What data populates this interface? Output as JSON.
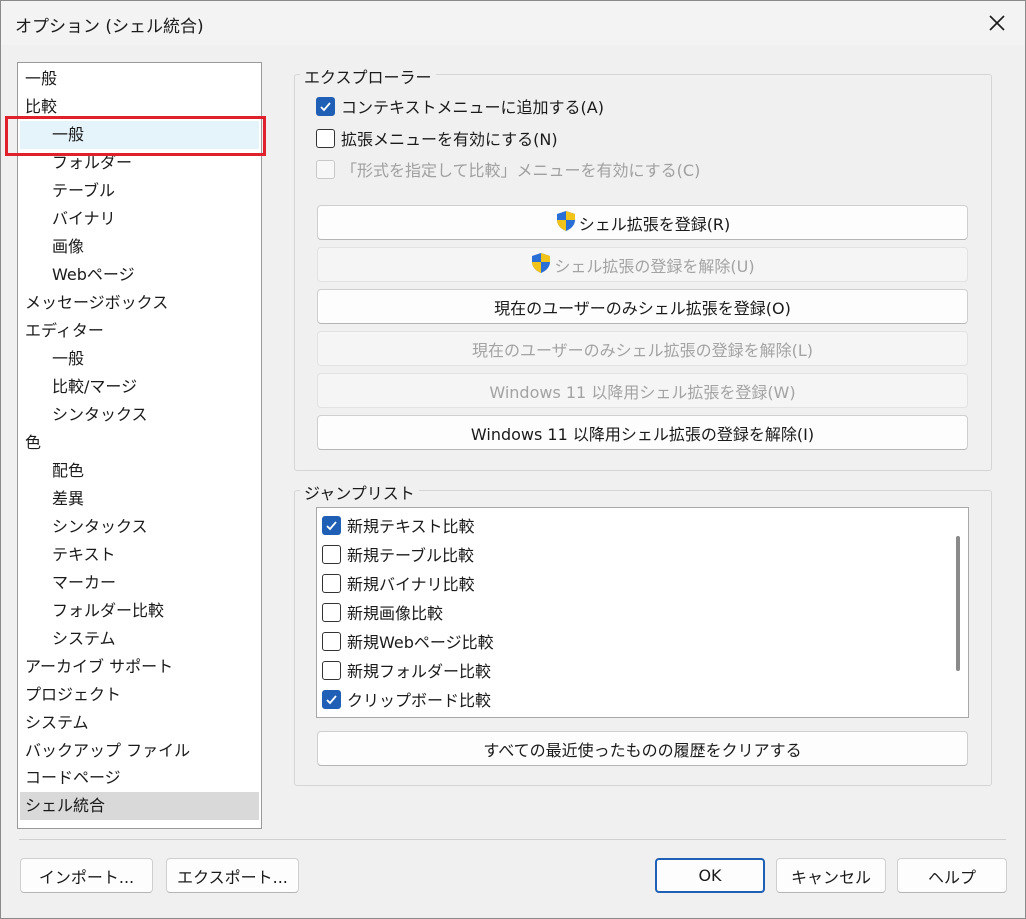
{
  "window": {
    "title": "オプション (シェル統合)"
  },
  "tree": {
    "items": [
      {
        "label": "一般",
        "level": 0
      },
      {
        "label": "比較",
        "level": 0
      },
      {
        "label": "一般",
        "level": 1
      },
      {
        "label": "フォルダー",
        "level": 1
      },
      {
        "label": "テーブル",
        "level": 1
      },
      {
        "label": "バイナリ",
        "level": 1
      },
      {
        "label": "画像",
        "level": 1
      },
      {
        "label": "Webページ",
        "level": 1
      },
      {
        "label": "メッセージボックス",
        "level": 0
      },
      {
        "label": "エディター",
        "level": 0
      },
      {
        "label": "一般",
        "level": 1
      },
      {
        "label": "比較/マージ",
        "level": 1
      },
      {
        "label": "シンタックス",
        "level": 1
      },
      {
        "label": "色",
        "level": 0
      },
      {
        "label": "配色",
        "level": 1
      },
      {
        "label": "差異",
        "level": 1
      },
      {
        "label": "シンタックス",
        "level": 1
      },
      {
        "label": "テキスト",
        "level": 1
      },
      {
        "label": "マーカー",
        "level": 1
      },
      {
        "label": "フォルダー比較",
        "level": 1
      },
      {
        "label": "システム",
        "level": 1
      },
      {
        "label": "アーカイブ サポート",
        "level": 0
      },
      {
        "label": "プロジェクト",
        "level": 0
      },
      {
        "label": "システム",
        "level": 0
      },
      {
        "label": "バックアップ ファイル",
        "level": 0
      },
      {
        "label": "コードページ",
        "level": 0
      },
      {
        "label": "シェル統合",
        "level": 0
      }
    ]
  },
  "explorer": {
    "label": "エクスプローラー",
    "checks": [
      {
        "label": "コンテキストメニューに追加する(A)",
        "checked": true,
        "disabled": false
      },
      {
        "label": "拡張メニューを有効にする(N)",
        "checked": false,
        "disabled": false
      },
      {
        "label": "「形式を指定して比較」メニューを有効にする(C)",
        "checked": false,
        "disabled": true
      }
    ],
    "buttons": [
      {
        "label": "シェル拡張を登録(R)",
        "disabled": false,
        "shield": true
      },
      {
        "label": "シェル拡張の登録を解除(U)",
        "disabled": true,
        "shield": true
      },
      {
        "label": "現在のユーザーのみシェル拡張を登録(O)",
        "disabled": false,
        "shield": false
      },
      {
        "label": "現在のユーザーのみシェル拡張の登録を解除(L)",
        "disabled": true,
        "shield": false
      },
      {
        "label": "Windows 11 以降用シェル拡張を登録(W)",
        "disabled": true,
        "shield": false
      },
      {
        "label": "Windows 11 以降用シェル拡張の登録を解除(I)",
        "disabled": false,
        "shield": false
      }
    ]
  },
  "jumplist": {
    "label": "ジャンプリスト",
    "items": [
      {
        "label": "新規テキスト比較",
        "checked": true
      },
      {
        "label": "新規テーブル比較",
        "checked": false
      },
      {
        "label": "新規バイナリ比較",
        "checked": false
      },
      {
        "label": "新規画像比較",
        "checked": false
      },
      {
        "label": "新規Webページ比較",
        "checked": false
      },
      {
        "label": "新規フォルダー比較",
        "checked": false
      },
      {
        "label": "クリップボード比較",
        "checked": true
      }
    ],
    "clear_button": "すべての最近使ったものの履歴をクリアする"
  },
  "footer": {
    "import": "インポート...",
    "export": "エクスポート...",
    "ok": "OK",
    "cancel": "キャンセル",
    "help": "ヘルプ"
  },
  "colors": {
    "accent": "#1f5fb5",
    "highlight_box": "#e0202b"
  }
}
